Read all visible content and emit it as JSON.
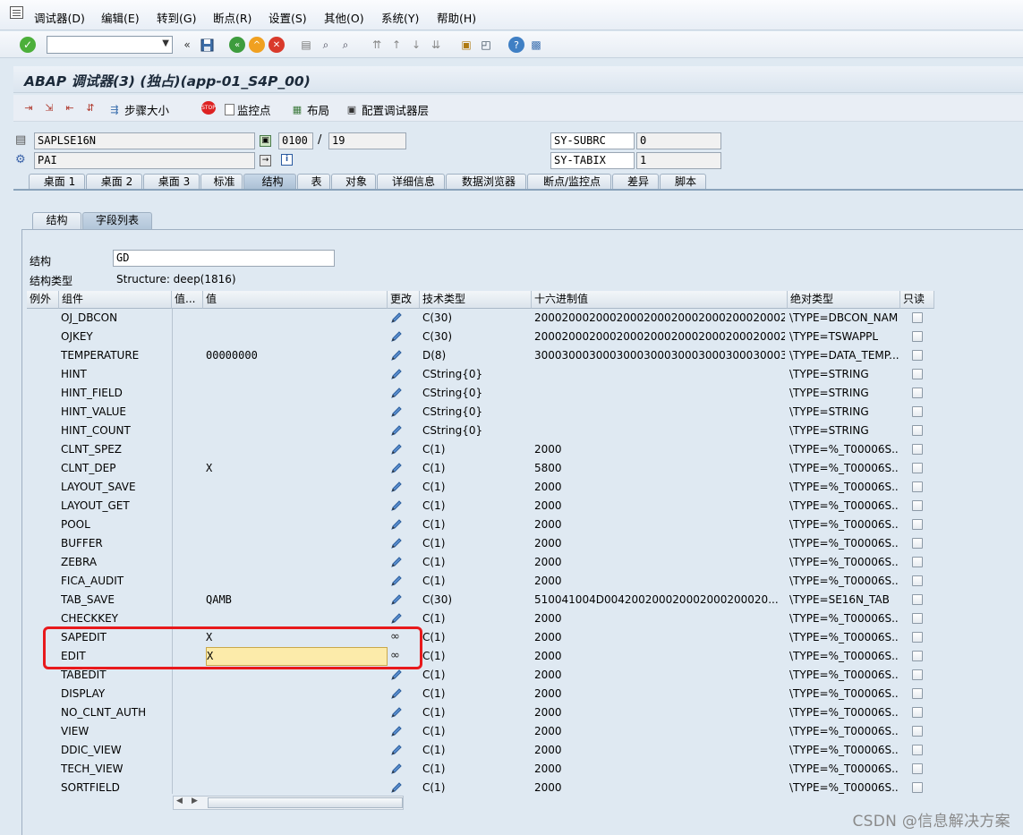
{
  "menu": [
    "调试器(D)",
    "编辑(E)",
    "转到(G)",
    "断点(R)",
    "设置(S)",
    "其他(O)",
    "系统(Y)",
    "帮助(H)"
  ],
  "title": "ABAP 调试器(3) (独占)(app-01_S4P_00)",
  "app_toolbar": {
    "step_size": "步骤大小",
    "watchpoint": "监控点",
    "layout": "布局",
    "configure_layers": "配置调试器层"
  },
  "info": {
    "program": "SAPLSE16N",
    "screen": "0100",
    "slash": "/",
    "line": "19",
    "event": "PAI",
    "sy_subrc_label": "SY-SUBRC",
    "sy_subrc_value": "0",
    "sy_tabix_label": "SY-TABIX",
    "sy_tabix_value": "1"
  },
  "tabs": [
    "桌面 1",
    "桌面 2",
    "桌面 3",
    "标准",
    "结构",
    "表",
    "对象",
    "详细信息",
    "数据浏览器",
    "断点/监控点",
    "差异",
    "脚本"
  ],
  "active_tab": "结构",
  "subtabs": [
    "结构",
    "字段列表"
  ],
  "active_subtab": "字段列表",
  "structure": {
    "label": "结构",
    "value": "GD",
    "type_label": "结构类型",
    "type_value": "Structure: deep(1816)"
  },
  "grid": {
    "columns": [
      "例外",
      "组件",
      "值...",
      "值",
      "更改",
      "技术类型",
      "十六进制值",
      "绝对类型",
      "只读"
    ],
    "rows": [
      {
        "component": "OJ_DBCON",
        "value": "",
        "type": "C(30)",
        "hex": "20002000200020002000200020002000200020...",
        "abs": "\\TYPE=DBCON_NAME"
      },
      {
        "component": "OJKEY",
        "value": "",
        "type": "C(30)",
        "hex": "20002000200020002000200020002000200020...",
        "abs": "\\TYPE=TSWAPPL"
      },
      {
        "component": "TEMPERATURE",
        "value": "00000000",
        "type": "D(8)",
        "hex": "3000300030003000300030003000300030003000",
        "abs": "\\TYPE=DATA_TEMP..."
      },
      {
        "component": "HINT",
        "value": "",
        "type": "CString{0}",
        "hex": "",
        "abs": "\\TYPE=STRING"
      },
      {
        "component": "HINT_FIELD",
        "value": "",
        "type": "CString{0}",
        "hex": "",
        "abs": "\\TYPE=STRING"
      },
      {
        "component": "HINT_VALUE",
        "value": "",
        "type": "CString{0}",
        "hex": "",
        "abs": "\\TYPE=STRING"
      },
      {
        "component": "HINT_COUNT",
        "value": "",
        "type": "CString{0}",
        "hex": "",
        "abs": "\\TYPE=STRING"
      },
      {
        "component": "CLNT_SPEZ",
        "value": "",
        "type": "C(1)",
        "hex": "2000",
        "abs": "\\TYPE=%_T00006S..."
      },
      {
        "component": "CLNT_DEP",
        "value": "X",
        "type": "C(1)",
        "hex": "5800",
        "abs": "\\TYPE=%_T00006S..."
      },
      {
        "component": "LAYOUT_SAVE",
        "value": "",
        "type": "C(1)",
        "hex": "2000",
        "abs": "\\TYPE=%_T00006S..."
      },
      {
        "component": "LAYOUT_GET",
        "value": "",
        "type": "C(1)",
        "hex": "2000",
        "abs": "\\TYPE=%_T00006S..."
      },
      {
        "component": "POOL",
        "value": "",
        "type": "C(1)",
        "hex": "2000",
        "abs": "\\TYPE=%_T00006S..."
      },
      {
        "component": "BUFFER",
        "value": "",
        "type": "C(1)",
        "hex": "2000",
        "abs": "\\TYPE=%_T00006S..."
      },
      {
        "component": "ZEBRA",
        "value": "",
        "type": "C(1)",
        "hex": "2000",
        "abs": "\\TYPE=%_T00006S..."
      },
      {
        "component": "FICA_AUDIT",
        "value": "",
        "type": "C(1)",
        "hex": "2000",
        "abs": "\\TYPE=%_T00006S..."
      },
      {
        "component": "TAB_SAVE",
        "value": "QAMB",
        "type": "C(30)",
        "hex": "510041004D004200200020002000200020...",
        "abs": "\\TYPE=SE16N_TAB"
      },
      {
        "component": "CHECKKEY",
        "value": "",
        "type": "C(1)",
        "hex": "2000",
        "abs": "\\TYPE=%_T00006S..."
      },
      {
        "component": "SAPEDIT",
        "value": "X",
        "type": "C(1)",
        "hex": "2000",
        "abs": "\\TYPE=%_T00006S..."
      },
      {
        "component": "EDIT",
        "value": "X",
        "type": "C(1)",
        "hex": "2000",
        "abs": "\\TYPE=%_T00006S..."
      },
      {
        "component": "TABEDIT",
        "value": "",
        "type": "C(1)",
        "hex": "2000",
        "abs": "\\TYPE=%_T00006S..."
      },
      {
        "component": "DISPLAY",
        "value": "",
        "type": "C(1)",
        "hex": "2000",
        "abs": "\\TYPE=%_T00006S..."
      },
      {
        "component": "NO_CLNT_AUTH",
        "value": "",
        "type": "C(1)",
        "hex": "2000",
        "abs": "\\TYPE=%_T00006S..."
      },
      {
        "component": "VIEW",
        "value": "",
        "type": "C(1)",
        "hex": "2000",
        "abs": "\\TYPE=%_T00006S..."
      },
      {
        "component": "DDIC_VIEW",
        "value": "",
        "type": "C(1)",
        "hex": "2000",
        "abs": "\\TYPE=%_T00006S..."
      },
      {
        "component": "TECH_VIEW",
        "value": "",
        "type": "C(1)",
        "hex": "2000",
        "abs": "\\TYPE=%_T00006S..."
      },
      {
        "component": "SORTFIELD",
        "value": "",
        "type": "C(1)",
        "hex": "2000",
        "abs": "\\TYPE=%_T00006S..."
      }
    ]
  },
  "watermark": "CSDN @信息解决方案",
  "colors": {
    "background": "#dfe9f2",
    "highlight_border": "#e8191c",
    "edit_cell": "#fcebaa"
  }
}
